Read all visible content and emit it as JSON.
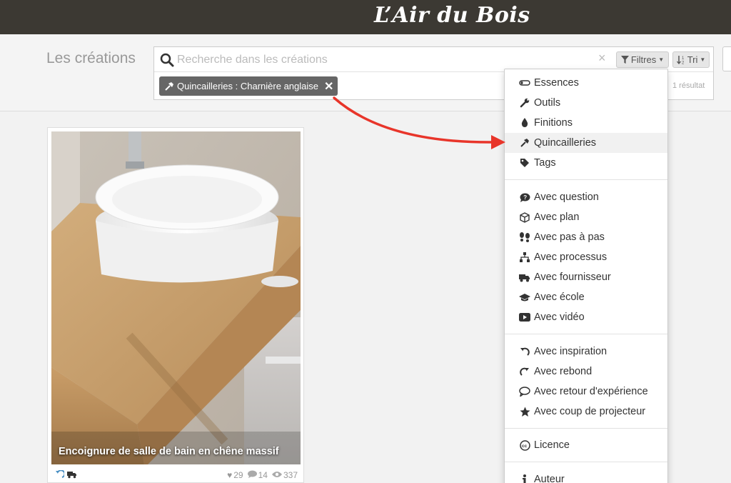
{
  "brand": "L’Air du Bois",
  "page_title": "Les créations",
  "search": {
    "placeholder": "Recherche dans les créations",
    "clear_glyph": "×",
    "filters_label": "Filtres",
    "sort_label": "Tri",
    "active_filter": "Quincailleries : Charnière anglaise",
    "result_count": "1 résultat"
  },
  "card": {
    "title": "Encoignure de salle de bain en chêne massif",
    "likes": "29",
    "comments": "14",
    "views": "337"
  },
  "menu": {
    "items": [
      {
        "label": "Essences",
        "icon": "essence-icon"
      },
      {
        "label": "Outils",
        "icon": "wrench-icon"
      },
      {
        "label": "Finitions",
        "icon": "drop-icon"
      },
      {
        "label": "Quincailleries",
        "icon": "hammer-icon"
      },
      {
        "label": "Tags",
        "icon": "tag-icon"
      },
      {
        "label": "Avec question",
        "icon": "question-bubble-icon"
      },
      {
        "label": "Avec plan",
        "icon": "cube-icon"
      },
      {
        "label": "Avec pas à pas",
        "icon": "footsteps-icon"
      },
      {
        "label": "Avec processus",
        "icon": "sitemap-icon"
      },
      {
        "label": "Avec fournisseur",
        "icon": "truck-icon"
      },
      {
        "label": "Avec école",
        "icon": "graduation-cap-icon"
      },
      {
        "label": "Avec vidéo",
        "icon": "video-icon"
      },
      {
        "label": "Avec inspiration",
        "icon": "undo-arrow-icon"
      },
      {
        "label": "Avec rebond",
        "icon": "redo-arrow-icon"
      },
      {
        "label": "Avec retour d'expérience",
        "icon": "feedback-bubble-icon"
      },
      {
        "label": "Avec coup de projecteur",
        "icon": "star-icon"
      },
      {
        "label": "Licence",
        "icon": "creative-commons-icon"
      },
      {
        "label": "Auteur",
        "icon": "info-icon"
      }
    ]
  },
  "colors": {
    "topbar": "#3c3933",
    "annotation_arrow": "#e8352a",
    "chip_bg": "#666666"
  }
}
